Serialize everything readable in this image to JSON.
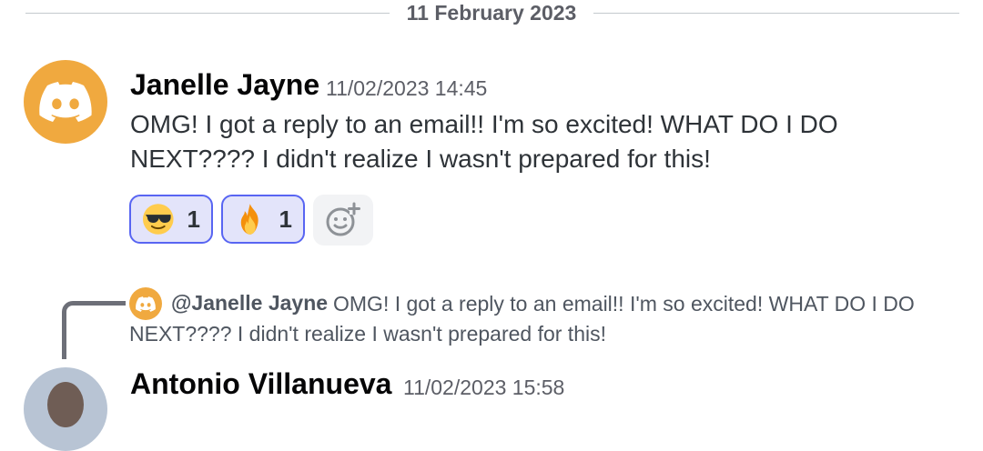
{
  "divider": {
    "date": "11 February 2023"
  },
  "messages": [
    {
      "author": "Janelle Jayne",
      "timestamp": "11/02/2023 14:45",
      "content": "OMG! I got a reply to an email!! I'm so excited! WHAT DO I DO NEXT???? I didn't realize I wasn't prepared for this!",
      "reactions": [
        {
          "emoji": "sunglasses-face",
          "count": "1"
        },
        {
          "emoji": "fire",
          "count": "1"
        }
      ],
      "avatar_color": "#f0a93f"
    },
    {
      "reply_to": {
        "author": "@Janelle Jayne",
        "content": "OMG! I got a reply to an email!! I'm so excited! WHAT DO I DO NEXT???? I didn't realize I wasn't prepared for this!"
      },
      "author": "Antonio Villanueva",
      "timestamp": "11/02/2023 15:58"
    }
  ],
  "colors": {
    "accent": "#5865f2",
    "reaction_bg": "#e3e4fa",
    "avatar": "#f0a93f",
    "text": "#2e3338",
    "muted": "#5c5e66"
  }
}
